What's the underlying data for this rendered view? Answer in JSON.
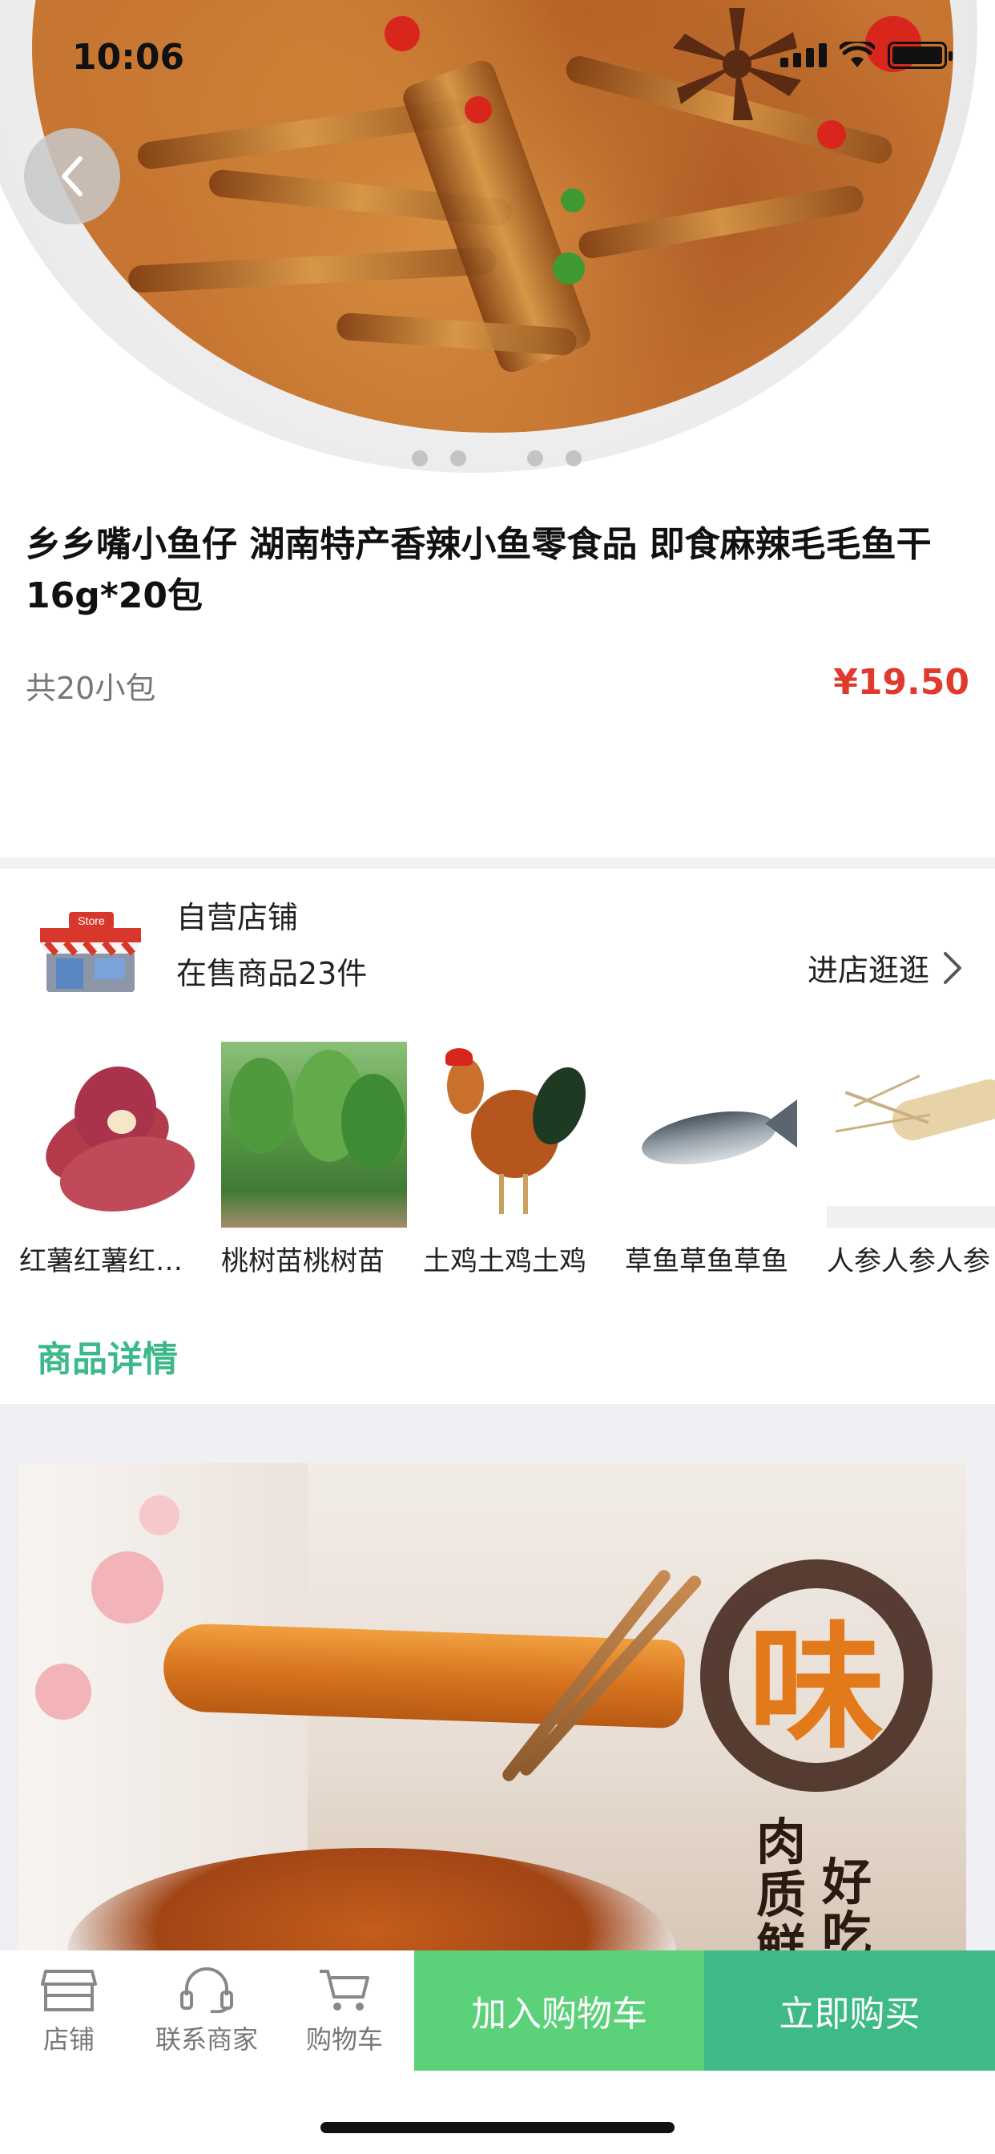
{
  "status_bar": {
    "time": "10:06"
  },
  "gallery": {
    "dot_count": 4,
    "active_index": 0
  },
  "product": {
    "title": "乡乡嘴小鱼仔 湖南特产香辣小鱼零食品 即食麻辣毛毛鱼干16g*20包",
    "spec": "共20小包",
    "price": "¥19.50"
  },
  "store": {
    "name": "自营店铺",
    "items_on_sale": "在售商品23件",
    "visit_label": "进店逛逛",
    "icon_text": "Store"
  },
  "store_products": [
    {
      "name": "红薯红薯红薯红薯",
      "icon": "sweet-potato"
    },
    {
      "name": "桃树苗桃树苗",
      "icon": "peach-sapling"
    },
    {
      "name": "土鸡土鸡土鸡",
      "icon": "rooster"
    },
    {
      "name": "草鱼草鱼草鱼",
      "icon": "grass-carp"
    },
    {
      "name": "人参人参人参",
      "icon": "ginseng"
    }
  ],
  "detail": {
    "section_label": "商品详情",
    "banner": {
      "stamp_char": "味",
      "poem_col1": "肉质鲜",
      "poem_col2": "好吃"
    }
  },
  "bottom_bar": {
    "tabs": [
      {
        "label": "店铺",
        "icon": "store-icon"
      },
      {
        "label": "联系商家",
        "icon": "headset-icon"
      },
      {
        "label": "购物车",
        "icon": "cart-icon"
      }
    ],
    "add_to_cart": "加入购物车",
    "buy_now": "立即购买"
  },
  "colors": {
    "price": "#e03a2e",
    "accent_green": "#3bb98a",
    "cart_button": "#5bd17a",
    "buy_button": "#3dba86"
  }
}
